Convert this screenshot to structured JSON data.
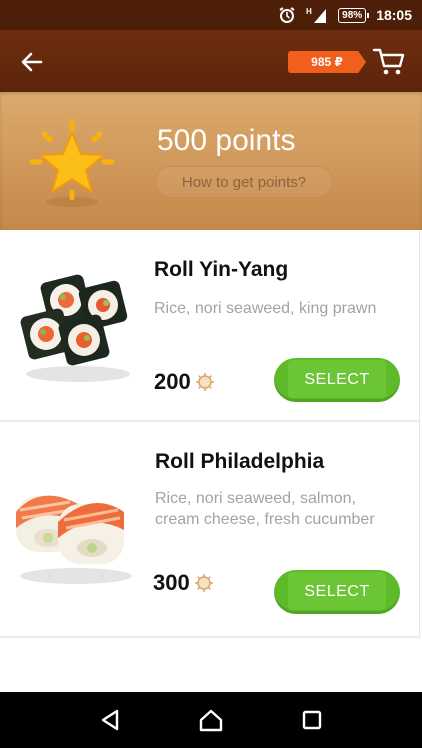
{
  "status_bar": {
    "time": "18:05",
    "battery": "98%",
    "icons": [
      "alarm-icon",
      "signal-icon",
      "battery-icon"
    ]
  },
  "app_bar": {
    "balance": "985 ₽",
    "icons": [
      "back-arrow-icon",
      "cart-icon"
    ]
  },
  "banner": {
    "points_title": "500 points",
    "points_link": "How to get points?",
    "icon": "star-icon"
  },
  "products": [
    {
      "name": "Roll Yin-Yang",
      "description": "Rice, nori seaweed, king prawn",
      "price": "200",
      "button": "SELECT",
      "image": "sushi-roll-image"
    },
    {
      "name": "Roll Philadelphia",
      "description": "Rice, nori seaweed, salmon, cream cheese, fresh cucumber",
      "price": "300",
      "button": "SELECT",
      "image": "salmon-roll-image"
    }
  ],
  "nav_bar": {
    "icons": [
      "back-triangle-icon",
      "home-icon",
      "recents-icon"
    ]
  },
  "colors": {
    "status_bar": "#4e1f08",
    "app_bar": "#6e2e0e",
    "banner": "#d19c5e",
    "accent_orange": "#f25f1c",
    "select_green": "#5dbb2a"
  }
}
